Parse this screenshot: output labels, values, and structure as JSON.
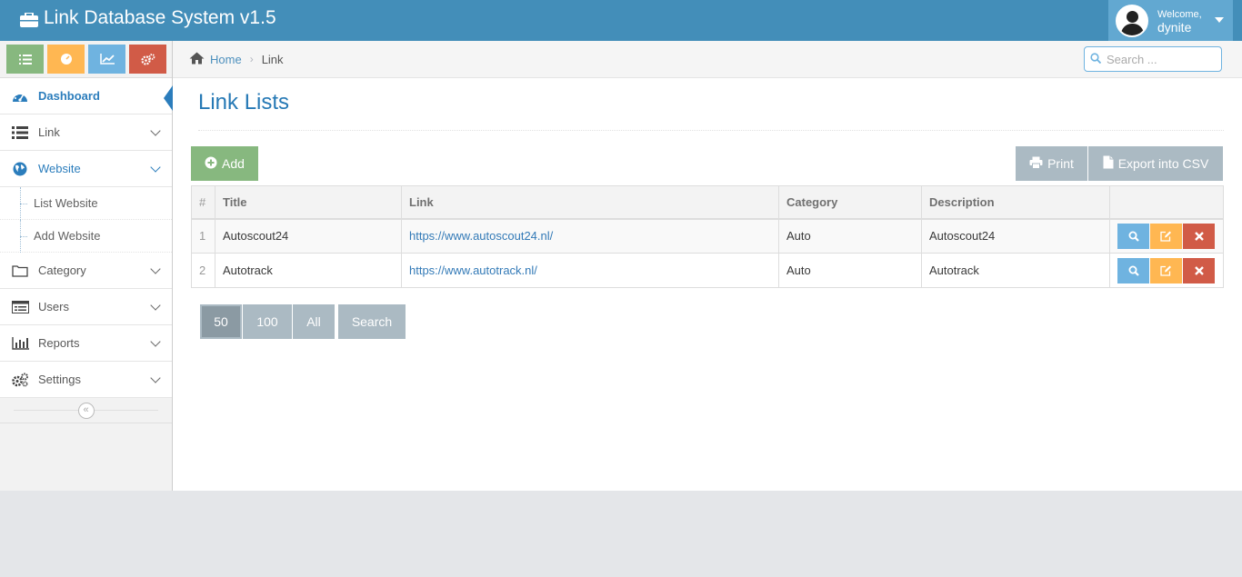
{
  "app": {
    "title": "Link Database System v1.5"
  },
  "user": {
    "welcome": "Welcome,",
    "name": "dynite"
  },
  "breadcrumb": {
    "home": "Home",
    "current": "Link"
  },
  "search": {
    "placeholder": "Search ..."
  },
  "sidebar": {
    "items": [
      {
        "label": "Dashboard",
        "icon": "dashboard-icon"
      },
      {
        "label": "Link",
        "icon": "list-icon"
      },
      {
        "label": "Website",
        "icon": "globe-icon"
      },
      {
        "label": "Category",
        "icon": "folder-icon"
      },
      {
        "label": "Users",
        "icon": "users-list-icon"
      },
      {
        "label": "Reports",
        "icon": "bar-chart-icon"
      },
      {
        "label": "Settings",
        "icon": "cogs-icon"
      }
    ],
    "submenu": [
      "List Website",
      "Add Website"
    ],
    "shortcut_colors": [
      "#87b87f",
      "#ffb752",
      "#6fb3e0",
      "#d15b47"
    ]
  },
  "page": {
    "title": "Link Lists"
  },
  "toolbar": {
    "add": "Add",
    "print": "Print",
    "export": "Export into CSV"
  },
  "table": {
    "headers": [
      "#",
      "Title",
      "Link",
      "Category",
      "Description"
    ],
    "rows": [
      {
        "num": "1",
        "title": "Autoscout24",
        "link": "https://www.autoscout24.nl/",
        "category": "Auto",
        "description": "Autoscout24"
      },
      {
        "num": "2",
        "title": "Autotrack",
        "link": "https://www.autotrack.nl/",
        "category": "Auto",
        "description": "Autotrack"
      }
    ]
  },
  "pager": {
    "options": [
      "50",
      "100",
      "All"
    ],
    "selected": "50",
    "search": "Search"
  },
  "colors": {
    "navbar": "#438eb9",
    "accent": "#2679b5",
    "success": "#87b87f",
    "warning": "#ffb752",
    "info": "#6fb3e0",
    "danger": "#d15b47",
    "gray": "#abbac3"
  }
}
